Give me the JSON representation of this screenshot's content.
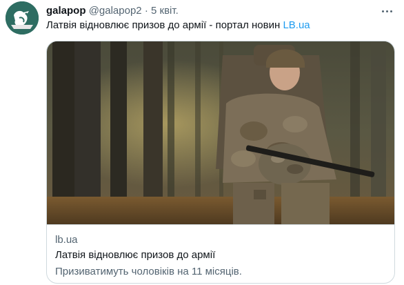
{
  "tweet": {
    "display_name": "galapop",
    "handle": "@galapop2",
    "separator": "·",
    "timestamp": "5 квіт.",
    "text": "Латвія відновлює призов до армії - портал новин ",
    "link_text": "LB.ua",
    "more_icon": "more-horizontal-icon",
    "avatar_icon": "bird-avatar-icon"
  },
  "card": {
    "domain": "lb.ua",
    "title": "Латвія відновлює призов до армії",
    "description": "Призиватимуть чоловіків на 11 місяців."
  },
  "colors": {
    "link": "#1d9bf0",
    "secondary_text": "#536471",
    "primary_text": "#0f1419",
    "border": "#cfd9de"
  }
}
